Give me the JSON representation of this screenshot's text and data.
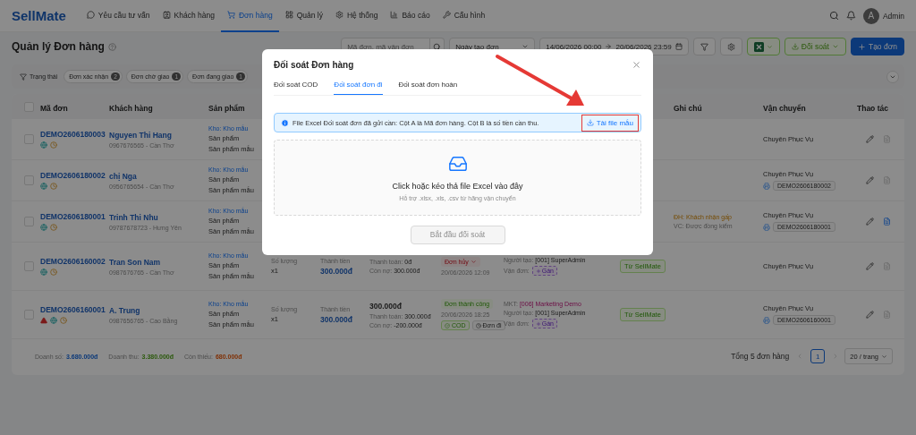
{
  "nav": {
    "logo": "SellMate",
    "items": [
      {
        "label": "Yêu cầu tư vấn",
        "selected": false
      },
      {
        "label": "Khách hàng",
        "selected": false
      },
      {
        "label": "Đơn hàng",
        "selected": true
      },
      {
        "label": "Quản lý",
        "selected": false
      },
      {
        "label": "Hệ thống",
        "selected": false
      },
      {
        "label": "Báo cáo",
        "selected": false
      },
      {
        "label": "Cấu hình",
        "selected": false
      }
    ],
    "user": {
      "avatar": "A",
      "name": "Admin"
    }
  },
  "toolbar": {
    "title": "Quản lý Đơn hàng",
    "search": {
      "placeholder": "Mã đơn, mã vận đơn"
    },
    "date_type": "Ngày tạo đơn",
    "date_start": "14/06/2026 00:00",
    "date_end": "20/06/2026 23:59",
    "reconcile_button": "Đối soát",
    "create_button": "Tạo đơn"
  },
  "filters": {
    "label": "Trạng thái",
    "chips": [
      {
        "label": "Đơn xác nhận",
        "count": "2"
      },
      {
        "label": "Đơn chờ giao",
        "count": "1"
      },
      {
        "label": "Đơn đang giao",
        "count": "1"
      }
    ]
  },
  "table": {
    "all_checked": false,
    "columns": [
      "Mã đơn",
      "Khách hàng",
      "Sản phẩm",
      "Ghi chú",
      "Vận chuyển",
      "Thao tác"
    ],
    "rows": [
      {
        "checked": false,
        "id": "DEMO2606180003",
        "warning": false,
        "customer": "Nguyen Thi Hang",
        "contact": "0967676565 - Cần Thơ",
        "warehouse": "Kho: Kho mẫu",
        "products": [
          "Sản phẩm",
          "Sản phẩm mẫu"
        ],
        "carrier": "Chuyên Phục Vụ",
        "invoice_ready": false
      },
      {
        "checked": false,
        "id": "DEMO2606180002",
        "warning": false,
        "customer": "chị Nga",
        "contact": "0956765654 - Cần Thơ",
        "warehouse": "Kho: Kho mẫu",
        "products": [
          "Sản phẩm",
          "Sản phẩm mẫu"
        ],
        "carrier": "Chuyên Phục Vụ",
        "tracking": "DEMO2606180002",
        "invoice_ready": false
      },
      {
        "checked": false,
        "id": "DEMO2606180001",
        "warning": false,
        "customer": "Trinh Thi Nhu",
        "contact": "09787678723 - Hưng Yên",
        "warehouse": "Kho: Kho mẫu",
        "products": [
          "Sản phẩm",
          "Sản phẩm mẫu"
        ],
        "note": {
          "order": "ĐH: Khách nhận gấp",
          "carrier": "VC: Được đồng kiểm"
        },
        "carrier": "Chuyên Phục Vụ",
        "tracking": "DEMO2606180001",
        "invoice_ready": true
      },
      {
        "checked": false,
        "id": "DEMO2606160002",
        "warning": false,
        "customer": "Tran Son Nam",
        "contact": "0987676765 - Cần Thơ",
        "warehouse": "Kho: Kho mẫu",
        "products": [
          "Sản phẩm",
          "Sản phẩm mẫu"
        ],
        "quantity": {
          "label": "Số lượng",
          "value": "x1"
        },
        "amount": {
          "label": "Thành tiền",
          "value": "300.000đ"
        },
        "payment": {
          "paid_label": "Thanh toán:",
          "paid": "0đ",
          "owed_label": "Còn nợ:",
          "owed": "300.000đ"
        },
        "status": {
          "label": "Đơn hủy",
          "kind": "cancelled",
          "has_menu": true,
          "date": "20/06/2026 12:09"
        },
        "creator_label": "Người tạo:",
        "creator": "[001] SuperAdmin",
        "waybill_label": "Vận đơn:",
        "waybill_button": "Gán",
        "source": "Từ SellMate",
        "carrier": "Chuyên Phục Vụ",
        "invoice_ready": false
      },
      {
        "checked": false,
        "id": "DEMO2606160001",
        "warning": true,
        "customer": "A. Trung",
        "contact": "0987656765 - Cao Bằng",
        "warehouse": "Kho: Kho mẫu",
        "products": [
          "Sản phẩm",
          "Sản phẩm mẫu"
        ],
        "quantity": {
          "label": "Số lượng",
          "value": "x1"
        },
        "amount": {
          "label": "Thành tiền",
          "value": "300.000đ"
        },
        "payment": {
          "total": "300.000đ",
          "paid_label": "Thanh toán:",
          "paid": "300.000đ",
          "owed_label": "Còn nợ:",
          "owed": "-200.000đ"
        },
        "status": {
          "label": "Đơn thành công",
          "kind": "success",
          "has_menu": false,
          "date": "20/06/2026 18:25",
          "badges": [
            {
              "label": "COD",
              "kind": "paid"
            },
            {
              "label": "Đơn đi",
              "kind": "outbound"
            }
          ]
        },
        "marketer_label": "MKT:",
        "marketer": "[006] Marketing Demo",
        "creator_label": "Người tạo:",
        "creator": "[001] SuperAdmin",
        "waybill_label": "Vận đơn:",
        "waybill_button": "Gán",
        "source": "Từ SellMate",
        "carrier": "Chuyên Phục Vụ",
        "tracking": "DEMO2606160001",
        "invoice_ready": false
      }
    ]
  },
  "summary": [
    {
      "label": "Doanh số:",
      "value": "3.680.000đ",
      "kind": "sales"
    },
    {
      "label": "Doanh thu:",
      "value": "3.380.000đ",
      "kind": "revenue"
    },
    {
      "label": "Còn thiếu:",
      "value": "680.000đ",
      "kind": "shortfall"
    }
  ],
  "pagination": {
    "total": "Tổng 5 đơn hàng",
    "pages": [
      {
        "label": "1",
        "selected": true
      }
    ],
    "page_size": "20 / trang"
  },
  "modal": {
    "title": "Đối soát Đơn hàng",
    "tabs": [
      {
        "label": "Đối soát COD",
        "selected": false
      },
      {
        "label": "Đối soát đơn đi",
        "selected": true
      },
      {
        "label": "Đối soát đơn hoàn",
        "selected": false
      }
    ],
    "alert": "File Excel Đối soát đơn đã gửi cần: Cột A là Mã đơn hàng. Cột B là số tiền cần thu.",
    "template_link": "Tải file mẫu",
    "highlighted": true,
    "dropzone": {
      "title": "Click hoặc kéo thả file Excel vào đây",
      "hint": "Hỗ trợ .xlsx, .xls, .csv từ hãng vận chuyển"
    },
    "submit": {
      "label": "Bắt đầu đối soát",
      "disabled": true
    }
  }
}
